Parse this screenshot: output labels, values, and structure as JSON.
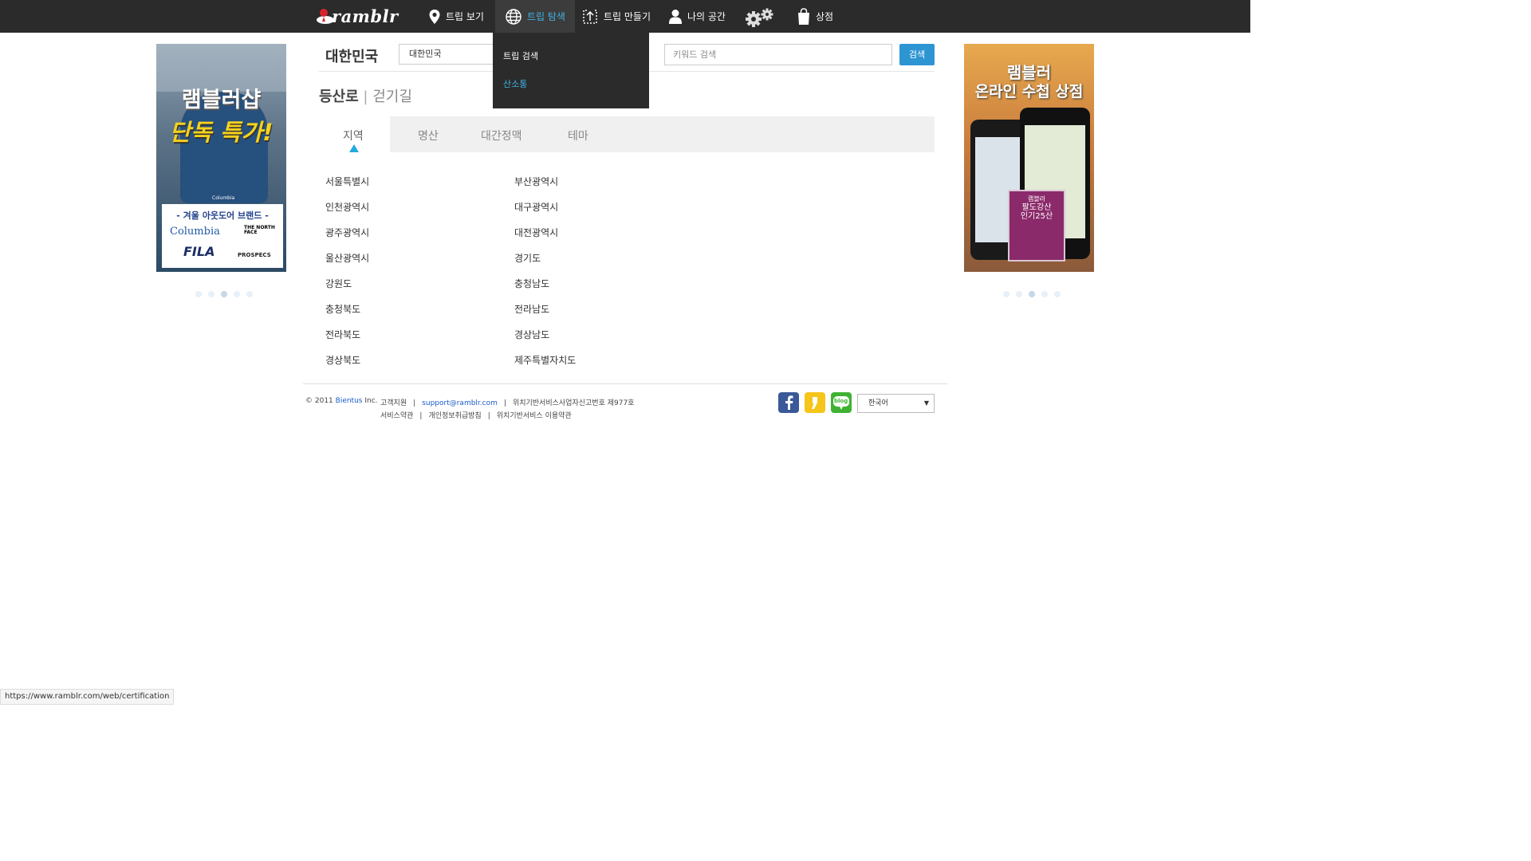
{
  "header": {
    "logo_text": "ramblr",
    "nav": [
      {
        "label": "트립 보기",
        "icon": "map-pin-icon"
      },
      {
        "label": "트립 탐색",
        "icon": "globe-icon",
        "active": true
      },
      {
        "label": "트립 만들기",
        "icon": "upload-icon"
      },
      {
        "label": "나의 공간",
        "icon": "user-icon"
      },
      {
        "label": "",
        "icon": "gears-icon"
      },
      {
        "label": "상점",
        "icon": "shopping-bag-icon"
      }
    ],
    "dropdown": [
      "트립 검색",
      "산소통"
    ]
  },
  "ads": {
    "left": {
      "headline1": "램블러샵",
      "headline2": "단독 특가!",
      "banner": "- 겨울 아웃도어 브랜드 -",
      "brands": [
        "Columbia",
        "THE NORTH FACE",
        "FILA",
        "PROSPECS"
      ],
      "jacket_brand": "Columbia",
      "active_dot": 3,
      "dots": 5
    },
    "right": {
      "headline1": "램블러",
      "headline2": "온라인 수첩 상점",
      "book_title": [
        "램블러",
        "팔도강산",
        "인기25산"
      ],
      "active_dot": 3,
      "dots": 5
    }
  },
  "search": {
    "country_label": "대한민국",
    "country_input": "대한민국",
    "keyword_placeholder": "키워드 검색",
    "button": "검색"
  },
  "category": {
    "primary": "등산로",
    "separator": "|",
    "secondary": "걷기길"
  },
  "tabs": [
    {
      "label": "지역",
      "active": true
    },
    {
      "label": "명산"
    },
    {
      "label": "대간정맥"
    },
    {
      "label": "테마"
    }
  ],
  "regions": {
    "col1": [
      "서울특별시",
      "인천광역시",
      "광주광역시",
      "울산광역시",
      "강원도",
      "충청북도",
      "전라북도",
      "경상북도"
    ],
    "col2": [
      "부산광역시",
      "대구광역시",
      "대전광역시",
      "경기도",
      "충청남도",
      "전라남도",
      "경상남도",
      "제주특별자치도"
    ]
  },
  "footer": {
    "copyright_prefix": "© 2011",
    "company": "Bientus",
    "company_suffix": "Inc.",
    "support_label": "고객지원",
    "email": "support@ramblr.com",
    "license": "위치기반서비스사업자신고번호 제977호",
    "links": [
      "서비스약관",
      "개인정보취급방침",
      "위치기반서비스 이용약관"
    ],
    "sns": [
      "facebook-icon",
      "kakaostory-icon",
      "naver-blog-icon"
    ],
    "sns_blog_label": "blog",
    "language": "한국어"
  },
  "status_url": "https://www.ramblr.com/web/certification",
  "colors": {
    "topbar": "#2b2b2b",
    "accent": "#3fb2e4",
    "button": "#2e95d3"
  }
}
